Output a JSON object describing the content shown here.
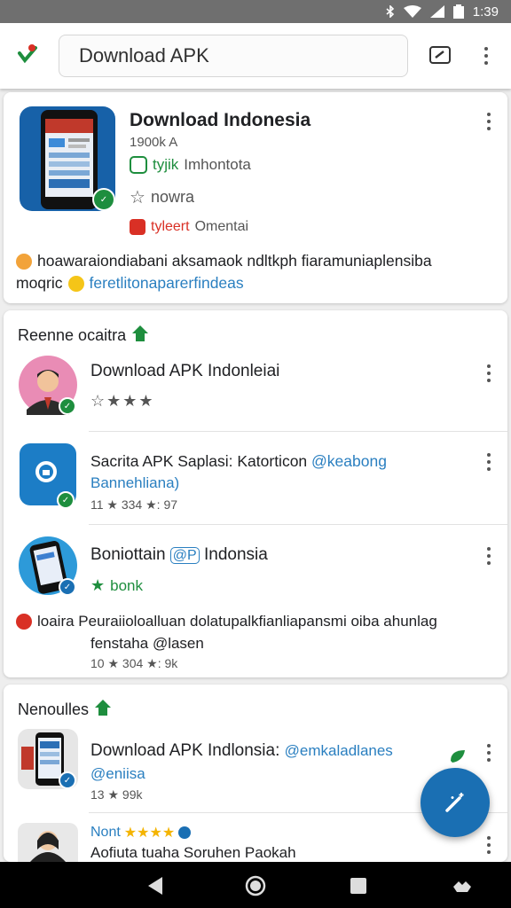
{
  "status_bar": {
    "time": "1:39",
    "icons": [
      "bluetooth-icon",
      "wifi-icon",
      "signal-icon",
      "battery-icon"
    ]
  },
  "search": {
    "query": "Download APK"
  },
  "featured": {
    "title": "Download Indonesia",
    "subtitle": "1900k A",
    "tag1_badge": "tyjik",
    "tag1_text": "Imhontota",
    "rating_text": "nowra",
    "tag2_badge": "tyleert",
    "tag2_text": "Omentai",
    "desc_line1": "hoawaraiondiabani aksamaok ndltkph fiaramuniaplensiba",
    "desc_line2_a": "moqric",
    "desc_line2_b": "feretlitonaparerfindeas"
  },
  "section1": {
    "header": "Reenne ocaitra",
    "items": [
      {
        "title": "Download APK Indonleiai",
        "stars": "☆★★★"
      },
      {
        "title_a": "Sacrita APK Saplasi: Katorticon",
        "title_b": "@keabong",
        "line2": "Bannehliana)",
        "meta": "11  ★ 334   ★: 97"
      },
      {
        "title_a": "Boniottain",
        "badge": "@P",
        "title_b": "Indonsia",
        "tag": "bonk"
      }
    ],
    "desc_line1": "loaira Peuraiioloalluan dolatupalkfianliapansmi oiba ahunlag",
    "desc_line2": "fenstaha @lasen",
    "desc_meta": "10  ★ 304   ★: 9k"
  },
  "section2": {
    "header": "Nenoulles",
    "items": [
      {
        "title": "Download APK Indlonsia:",
        "title_b": "@emkaladlanes",
        "line2": "@eniisa",
        "meta": "13  ★ 99k"
      },
      {
        "title_a": "Nont",
        "stars": "★★★★",
        "line2": "Aofiuta tuaha Soruhen Paokah"
      }
    ]
  },
  "colors": {
    "accent": "#1a6fb3",
    "link": "#2a7fc0",
    "green": "#1e8e3e",
    "red": "#d93025"
  }
}
